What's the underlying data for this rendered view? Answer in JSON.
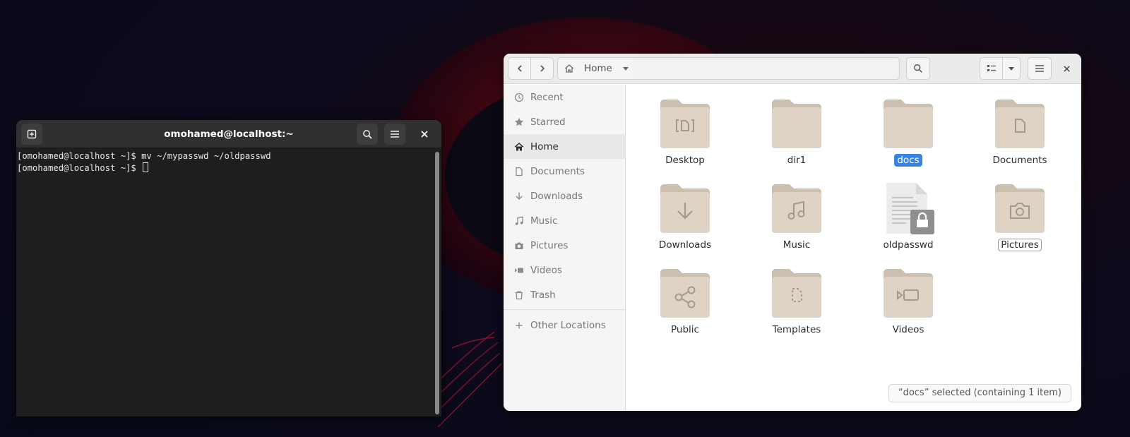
{
  "terminal": {
    "title": "omohamed@localhost:~",
    "lines": [
      "[omohamed@localhost ~]$ mv ~/mypasswd ~/oldpasswd",
      "[omohamed@localhost ~]$ "
    ]
  },
  "files": {
    "path": {
      "current": "Home"
    },
    "sidebar": {
      "items": [
        {
          "label": "Recent",
          "icon": "clock-icon"
        },
        {
          "label": "Starred",
          "icon": "star-icon"
        },
        {
          "label": "Home",
          "icon": "home-icon",
          "active": true
        },
        {
          "label": "Documents",
          "icon": "document-icon"
        },
        {
          "label": "Downloads",
          "icon": "download-icon"
        },
        {
          "label": "Music",
          "icon": "music-icon"
        },
        {
          "label": "Pictures",
          "icon": "camera-icon"
        },
        {
          "label": "Videos",
          "icon": "video-icon"
        },
        {
          "label": "Trash",
          "icon": "trash-icon"
        }
      ],
      "other_locations": "Other Locations"
    },
    "items": [
      {
        "name": "Desktop",
        "emblem": "desktop"
      },
      {
        "name": "dir1",
        "emblem": "none"
      },
      {
        "name": "docs",
        "emblem": "none",
        "selected": true
      },
      {
        "name": "Documents",
        "emblem": "document"
      },
      {
        "name": "Downloads",
        "emblem": "download"
      },
      {
        "name": "Music",
        "emblem": "music"
      },
      {
        "name": "oldpasswd",
        "emblem": "locked-file"
      },
      {
        "name": "Pictures",
        "emblem": "camera",
        "focused": true
      },
      {
        "name": "Public",
        "emblem": "share"
      },
      {
        "name": "Templates",
        "emblem": "template"
      },
      {
        "name": "Videos",
        "emblem": "video"
      }
    ],
    "status": "“docs” selected  (containing 1 item)"
  },
  "colors": {
    "folder_body": "#dfd3c6",
    "folder_tab": "#cdbfae",
    "folder_emblem": "#a89886",
    "selection": "#3584e4"
  }
}
